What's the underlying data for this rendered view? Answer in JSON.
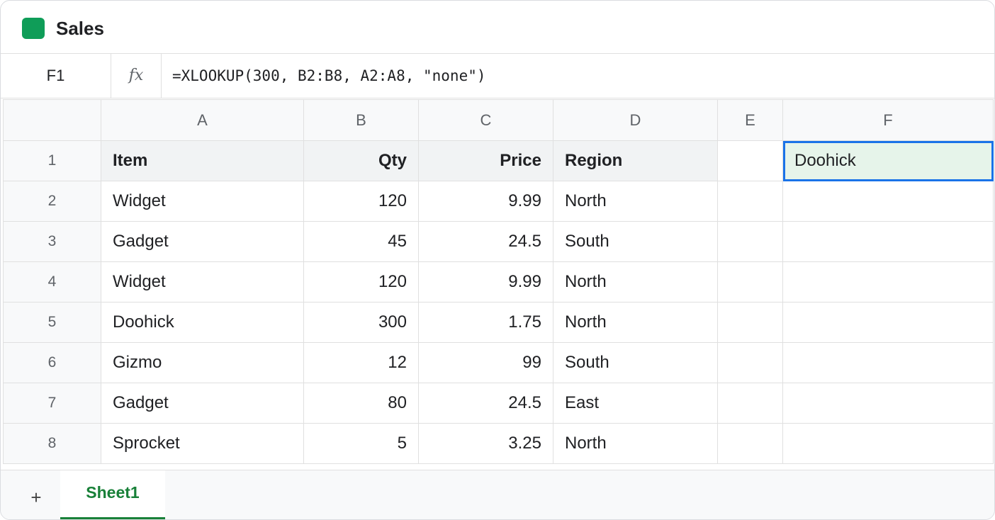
{
  "app": {
    "title": "Sales",
    "accent_color": "#0f9d58"
  },
  "formula_bar": {
    "cell_ref": "F1",
    "fx_label": "fx",
    "formula": "=XLOOKUP(300, B2:B8, A2:A8, \"none\")"
  },
  "grid": {
    "columns": [
      "A",
      "B",
      "C",
      "D",
      "E",
      "F"
    ],
    "rows": [
      {
        "num": "1",
        "cells": [
          "Item",
          "Qty",
          "Price",
          "Region",
          "",
          "Doohick"
        ]
      },
      {
        "num": "2",
        "cells": [
          "Widget",
          "120",
          "9.99",
          "North",
          "",
          ""
        ]
      },
      {
        "num": "3",
        "cells": [
          "Gadget",
          "45",
          "24.5",
          "South",
          "",
          ""
        ]
      },
      {
        "num": "4",
        "cells": [
          "Widget",
          "120",
          "9.99",
          "North",
          "",
          ""
        ]
      },
      {
        "num": "5",
        "cells": [
          "Doohick",
          "300",
          "1.75",
          "North",
          "",
          ""
        ]
      },
      {
        "num": "6",
        "cells": [
          "Gizmo",
          "12",
          "99",
          "South",
          "",
          ""
        ]
      },
      {
        "num": "7",
        "cells": [
          "Gadget",
          "80",
          "24.5",
          "East",
          "",
          ""
        ]
      },
      {
        "num": "8",
        "cells": [
          "Sprocket",
          "5",
          "3.25",
          "North",
          "",
          ""
        ]
      }
    ],
    "selected_cell": "F1",
    "selection_color": "#1a73e8"
  },
  "tabs": {
    "add_label": "+",
    "sheets": [
      {
        "label": "Sheet1",
        "active": true
      }
    ],
    "active_color": "#188038"
  }
}
